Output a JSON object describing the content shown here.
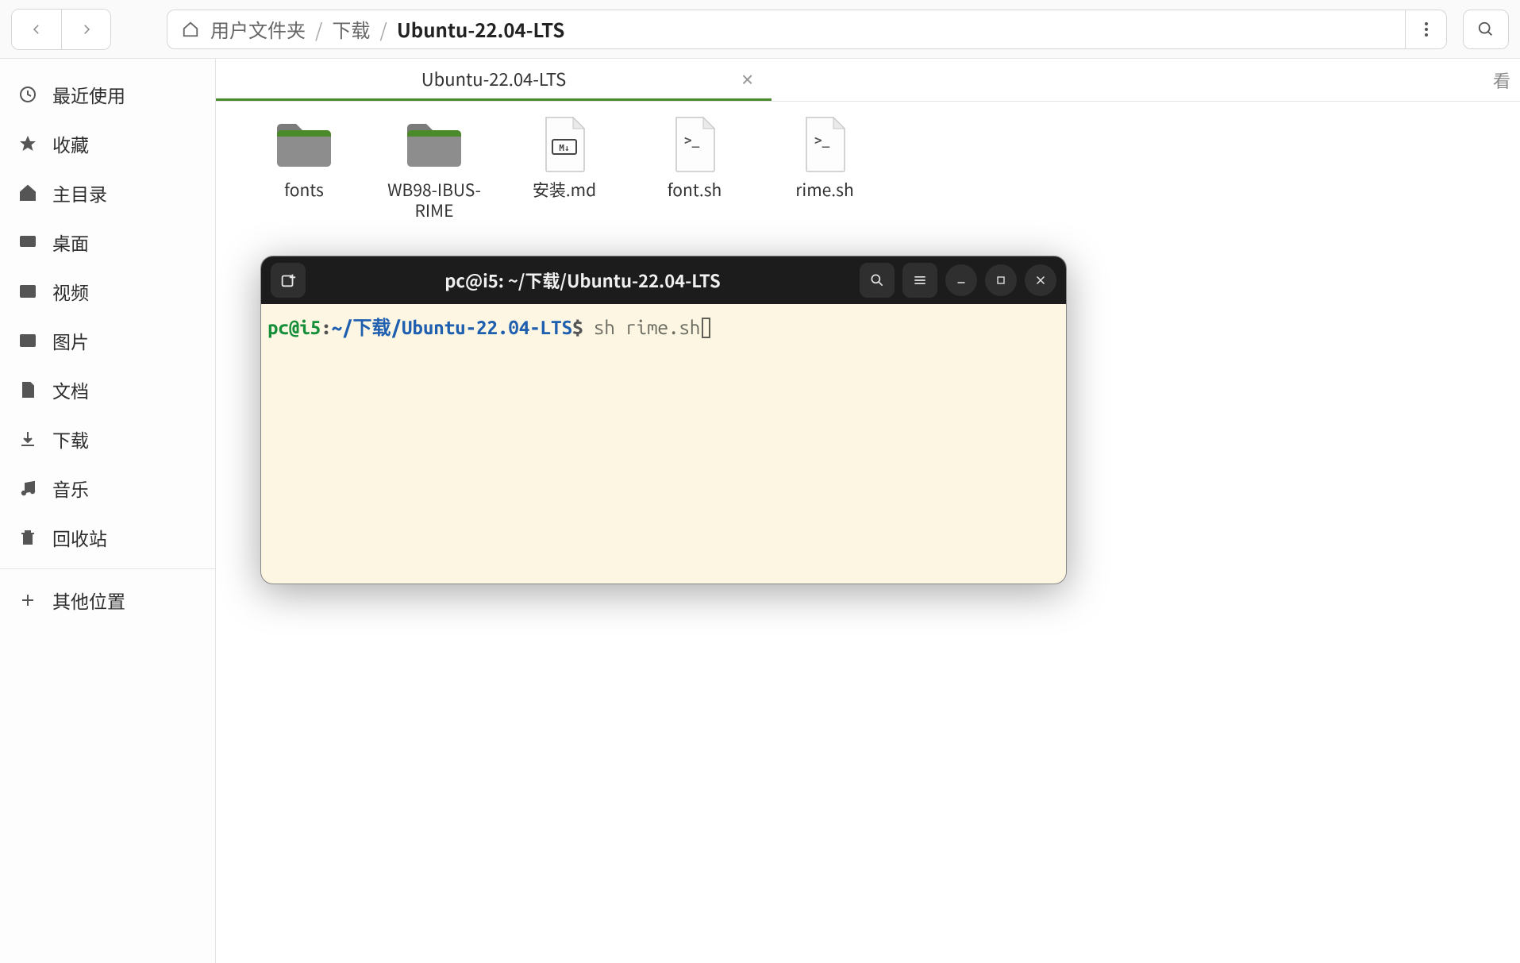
{
  "pathbar": {
    "home_label": "用户文件夹",
    "crumb1": "下载",
    "current": "Ubuntu-22.04-LTS"
  },
  "sidebar": {
    "items": [
      {
        "label": "最近使用"
      },
      {
        "label": "收藏"
      },
      {
        "label": "主目录"
      },
      {
        "label": "桌面"
      },
      {
        "label": "视频"
      },
      {
        "label": "图片"
      },
      {
        "label": "文档"
      },
      {
        "label": "下载"
      },
      {
        "label": "音乐"
      },
      {
        "label": "回收站"
      }
    ],
    "other_label": "其他位置"
  },
  "tab": {
    "label": "Ubuntu-22.04-LTS",
    "truncated": "看"
  },
  "files": [
    {
      "label": "fonts",
      "type": "folder"
    },
    {
      "label": "WB98-IBUS-RIME",
      "type": "folder"
    },
    {
      "label": "安装.md",
      "type": "md"
    },
    {
      "label": "font.sh",
      "type": "sh"
    },
    {
      "label": "rime.sh",
      "type": "sh"
    }
  ],
  "terminal": {
    "title": "pc@i5: ~/下载/Ubuntu-22.04-LTS",
    "user_host": "pc@i5",
    "path": "~/下载/Ubuntu-22.04-LTS",
    "prompt_char": "$",
    "command": "sh rime.sh"
  }
}
